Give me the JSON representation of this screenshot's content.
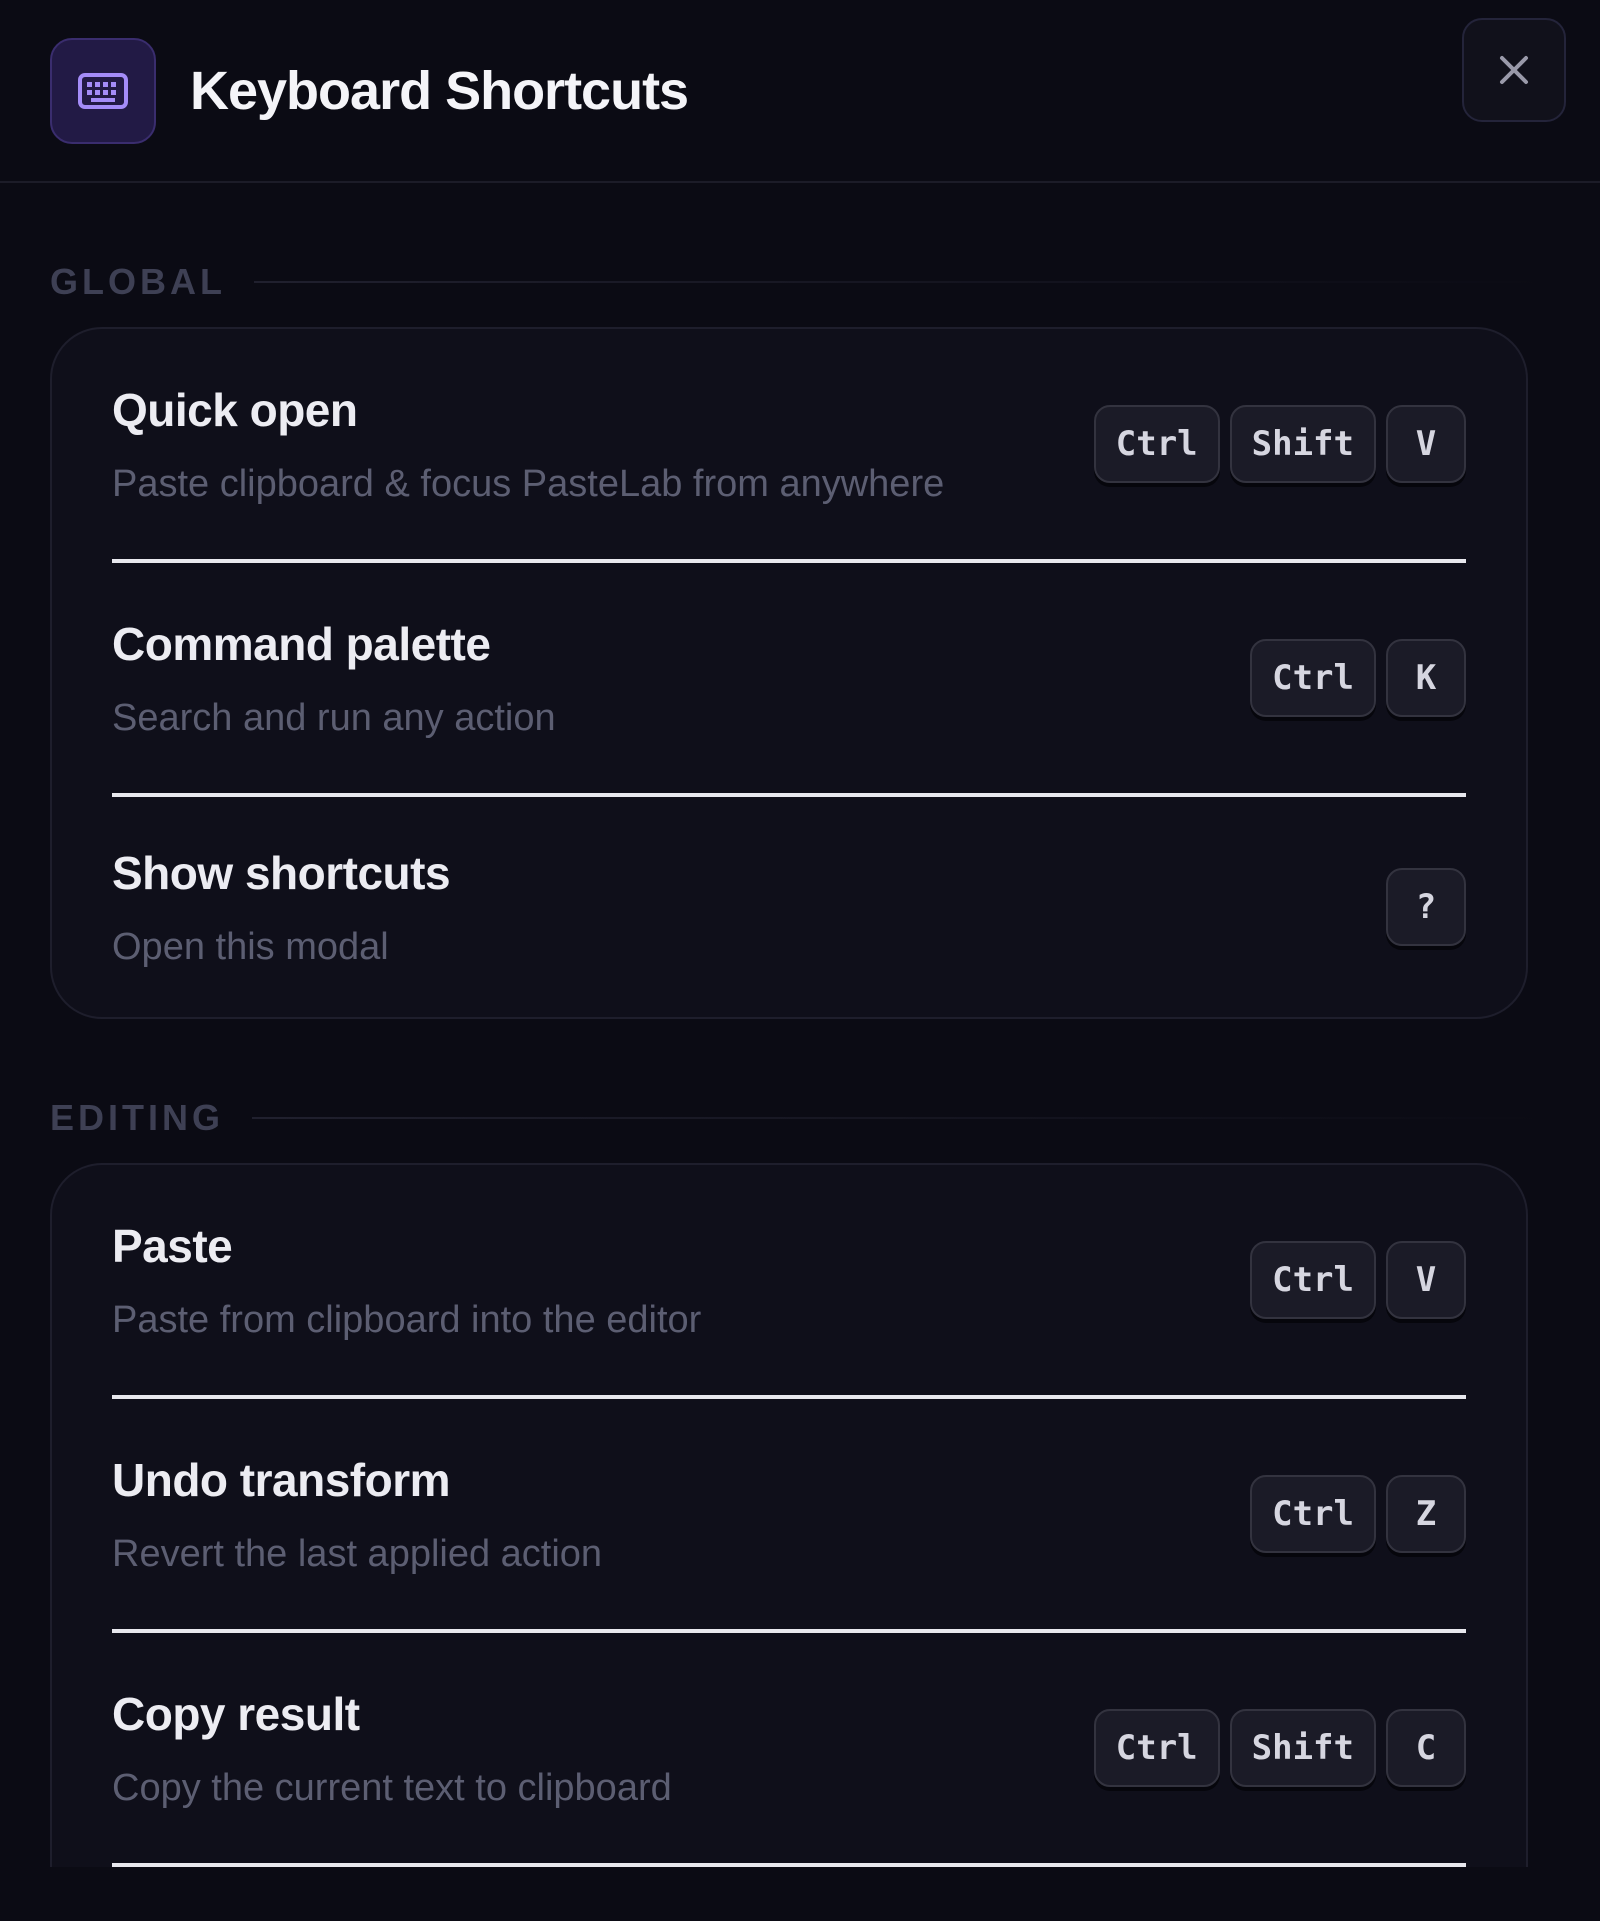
{
  "header": {
    "title": "Keyboard Shortcuts",
    "icon": "keyboard-icon",
    "close_icon": "close-icon",
    "accent": "#8b6cf0"
  },
  "sections": [
    {
      "label": "GLOBAL",
      "items": [
        {
          "title": "Quick open",
          "description": "Paste clipboard & focus PasteLab from anywhere",
          "keys": [
            "Ctrl",
            "Shift",
            "V"
          ]
        },
        {
          "title": "Command palette",
          "description": "Search and run any action",
          "keys": [
            "Ctrl",
            "K"
          ]
        },
        {
          "title": "Show shortcuts",
          "description": "Open this modal",
          "keys": [
            "?"
          ]
        }
      ]
    },
    {
      "label": "EDITING",
      "items": [
        {
          "title": "Paste",
          "description": "Paste from clipboard into the editor",
          "keys": [
            "Ctrl",
            "V"
          ]
        },
        {
          "title": "Undo transform",
          "description": "Revert the last applied action",
          "keys": [
            "Ctrl",
            "Z"
          ]
        },
        {
          "title": "Copy result",
          "description": "Copy the current text to clipboard",
          "keys": [
            "Ctrl",
            "Shift",
            "C"
          ]
        }
      ]
    }
  ]
}
